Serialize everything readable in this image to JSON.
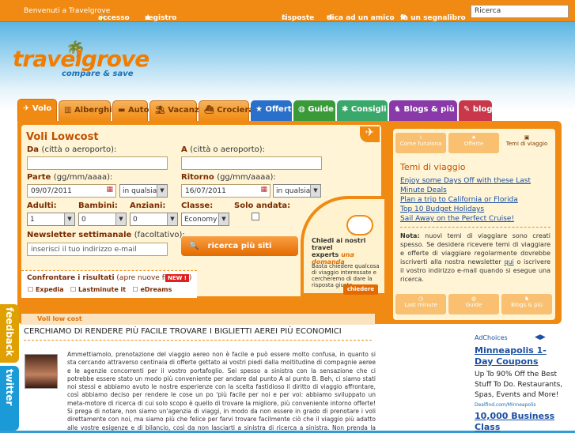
{
  "topbar": {
    "welcome": "Benvenuti a Travelgrove",
    "access": "accesso",
    "register": "registro",
    "answers": "risposte",
    "tell": "dica ad un amico",
    "bookmark": "fa un segnalibro",
    "search_placeholder": "Ricerca"
  },
  "logo": {
    "name": "travelgrove",
    "tagline": "compare & save"
  },
  "tabs": [
    {
      "label": "Volo"
    },
    {
      "label": "Alberghi"
    },
    {
      "label": "Auto"
    },
    {
      "label": "Vacanze"
    },
    {
      "label": "Crociera"
    },
    {
      "label": "Offerte"
    },
    {
      "label": "Guide"
    },
    {
      "label": "Consigli"
    },
    {
      "label": "Blogs & più"
    },
    {
      "label": "blog"
    }
  ],
  "form": {
    "title": "Voli Lowcost",
    "from_label": "Da",
    "from_hint": "(città o aeroporto):",
    "to_label": "A",
    "to_hint": "(città o aeroporto):",
    "depart_label": "Parte",
    "depart_hint": "(gg/mm/aaaa):",
    "depart_value": "09/07/2011",
    "depart_time": "in qualsia",
    "return_label": "Ritorno",
    "return_hint": "(gg/mm/aaaa):",
    "return_value": "16/07/2011",
    "return_time": "in qualsia",
    "adults_label": "Adulti:",
    "adults_value": "1",
    "children_label": "Bambini:",
    "children_value": "0",
    "seniors_label": "Anziani:",
    "seniors_value": "0",
    "class_label": "Classe:",
    "class_value": "Economy",
    "oneway_label": "Solo andata:",
    "newsletter_label": "Newsletter settimanale",
    "newsletter_hint": "(facoltativo):",
    "newsletter_placeholder": "inserisci il tuo indirizzo e-mail",
    "search_button": "ricerca più siti"
  },
  "compare": {
    "label": "Confrontare i risultati",
    "hint": "(apre nuove finestre)",
    "badge": "NEW !",
    "options": [
      "Expedia",
      "Lastminute it",
      "eDreams"
    ]
  },
  "experts": {
    "line1": "Chiedi ai nostri travel",
    "line2": "experts",
    "una": "una",
    "domanda": "domanda",
    "body": "Basta chiedere qualcosa di viaggio interessate e cercheremo di dare la risposta giusta",
    "button": "chiedere"
  },
  "right": {
    "tabs": [
      "Come funziona",
      "Offerte",
      "Temi di viaggio"
    ],
    "title": "Temi di viaggio",
    "links": [
      "Enjoy some Days Off with these Last Minute Deals",
      "Plan a trip to California or Florida",
      "Top 10 Budget Holidays",
      "Sail Away on the Perfect Cruise!"
    ],
    "note_bold": "Nota:",
    "note": "nuovi temi di viaggiare sono creati spesso. Se desidera ricevere temi di viaggiare e offerte di viaggiare regolarmente dovrebbe iscriverti alla nostra newsletter",
    "note_link": "qui",
    "note_end": "o iscrivere il vostro indirizzo e-mail quando si esegue una ricerca.",
    "bottom": [
      "Last minute",
      "Guide",
      "Blogs & più"
    ]
  },
  "section": {
    "header": "Voli low cost",
    "title": "CERCHIAMO DI RENDERE PIÙ FACILE TROVARE I BIGLIETTI AEREI PIÙ ECONOMICI",
    "body": "Ammettiamolo, prenotazione del viaggio aereo non è facile e può essere molto confusa, in quanto si sta cercando attraverso centinaia di offerte gettato ai vostri piedi dalla moltitudine di compagnie aeree e le agenzie concorrenti per il vostro portafoglio. Sei spesso a sinistra con la sensazione che ci potrebbe essere stato un modo più conveniente per andare dal punto A al punto B. Beh, ci siamo stati noi stessi e abbiamo avuto le nostre esperienze con la scelta fastidioso il diritto di viaggio affrontare, così abbiamo deciso per rendere le cose un po 'più facile per noi e per voi: abbiamo sviluppato un meta-motore di ricerca di cui solo scopo è quello di trovare la migliore, più conveniente intorno offerte! Si prega di notare, non siamo un'agenzia di viaggi, in modo da non essere in grado di prenotare i voli direttamente con noi, ma siamo più che felice per farvi trovare facilmente ciò che il viaggio più adatto alle vostre esigenze e di bilancio, così da non lasciarti a sinistra di ricerca a sinistra. Non prenda la nostra fiducia nel modo sbagliato, ma siamo disposti a ingoiare i nostri cappelli, se non dovessi trovare le migliori offerte con noi.)"
  },
  "ad": {
    "choices": "AdChoices",
    "headline": "Minneapolis 1-Day Coupons",
    "body": "Up To 90% Off the Best Stuff To Do. Restaurants, Spas, Events and More!",
    "url": "Dealfind.com/Minneapolis",
    "headline2": "10,000 Business Class"
  },
  "side": {
    "feedback": "feedback",
    "twitter": "twitter"
  }
}
